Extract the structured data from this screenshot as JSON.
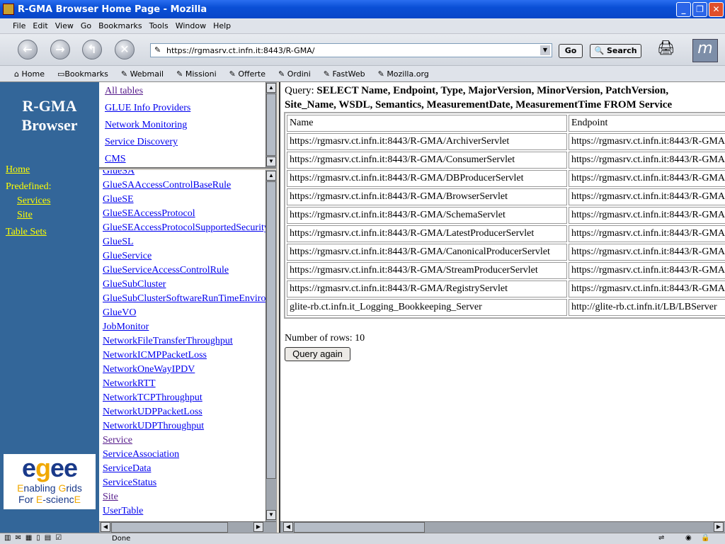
{
  "window": {
    "title": "R-GMA Browser Home Page - Mozilla"
  },
  "menu": [
    "File",
    "Edit",
    "View",
    "Go",
    "Bookmarks",
    "Tools",
    "Window",
    "Help"
  ],
  "nav": {
    "url": "https://rgmasrv.ct.infn.it:8443/R-GMA/",
    "go_label": "Go",
    "search_label": "Search"
  },
  "bookmarks": [
    "Home",
    "Bookmarks",
    "Webmail",
    "Missioni",
    "Offerte",
    "Ordini",
    "FastWeb",
    "Mozilla.org"
  ],
  "left": {
    "title_line1": "R-GMA",
    "title_line2": "Browser",
    "home": "Home",
    "predefined": "Predefined:",
    "services": "Services",
    "site": "Site",
    "table_sets": "Table Sets",
    "logo_text": "egee Enabling Grids For E-sciencE"
  },
  "table_sets": [
    "All tables",
    "GLUE Info Providers",
    "Network Monitoring",
    "Service Discovery",
    "CMS"
  ],
  "tables": [
    "GlueSA",
    "GlueSAAccessControlBaseRule",
    "GlueSE",
    "GlueSEAccessProtocol",
    "GlueSEAccessProtocolSupportedSecurity",
    "GlueSL",
    "GlueService",
    "GlueServiceAccessControlRule",
    "GlueSubCluster",
    "GlueSubClusterSoftwareRunTimeEnvironment",
    "GlueVO",
    "JobMonitor",
    "NetworkFileTransferThroughput",
    "NetworkICMPPacketLoss",
    "NetworkOneWayIPDV",
    "NetworkRTT",
    "NetworkTCPThroughput",
    "NetworkUDPPacketLoss",
    "NetworkUDPThroughput",
    "Service",
    "ServiceAssociation",
    "ServiceData",
    "ServiceStatus",
    "Site",
    "UserTable"
  ],
  "main": {
    "query_label": "Query:",
    "query": "SELECT Name, Endpoint, Type, MajorVersion, MinorVersion, PatchVersion, Site_Name, WSDL, Semantics, MeasurementDate, MeasurementTime FROM Service",
    "columns": [
      "Name",
      "Endpoint"
    ],
    "rows": [
      [
        "https://rgmasrv.ct.infn.it:8443/R-GMA/ArchiverServlet",
        "https://rgmasrv.ct.infn.it:8443/R-GMA"
      ],
      [
        "https://rgmasrv.ct.infn.it:8443/R-GMA/ConsumerServlet",
        "https://rgmasrv.ct.infn.it:8443/R-GMA"
      ],
      [
        "https://rgmasrv.ct.infn.it:8443/R-GMA/DBProducerServlet",
        "https://rgmasrv.ct.infn.it:8443/R-GMA"
      ],
      [
        "https://rgmasrv.ct.infn.it:8443/R-GMA/BrowserServlet",
        "https://rgmasrv.ct.infn.it:8443/R-GMA"
      ],
      [
        "https://rgmasrv.ct.infn.it:8443/R-GMA/SchemaServlet",
        "https://rgmasrv.ct.infn.it:8443/R-GMA"
      ],
      [
        "https://rgmasrv.ct.infn.it:8443/R-GMA/LatestProducerServlet",
        "https://rgmasrv.ct.infn.it:8443/R-GMA"
      ],
      [
        "https://rgmasrv.ct.infn.it:8443/R-GMA/CanonicalProducerServlet",
        "https://rgmasrv.ct.infn.it:8443/R-GMA"
      ],
      [
        "https://rgmasrv.ct.infn.it:8443/R-GMA/StreamProducerServlet",
        "https://rgmasrv.ct.infn.it:8443/R-GMA"
      ],
      [
        "https://rgmasrv.ct.infn.it:8443/R-GMA/RegistryServlet",
        "https://rgmasrv.ct.infn.it:8443/R-GMA"
      ],
      [
        "glite-rb.ct.infn.it_Logging_Bookkeeping_Server",
        "http://glite-rb.ct.infn.it/LB/LBServer"
      ]
    ],
    "row_count": "Number of rows: 10",
    "query_again": "Query again"
  },
  "status": {
    "text": "Done"
  },
  "colors": {
    "left_bg": "#336699",
    "left_link": "#ffff00",
    "link": "#0000ee",
    "visited": "#551a8b"
  }
}
